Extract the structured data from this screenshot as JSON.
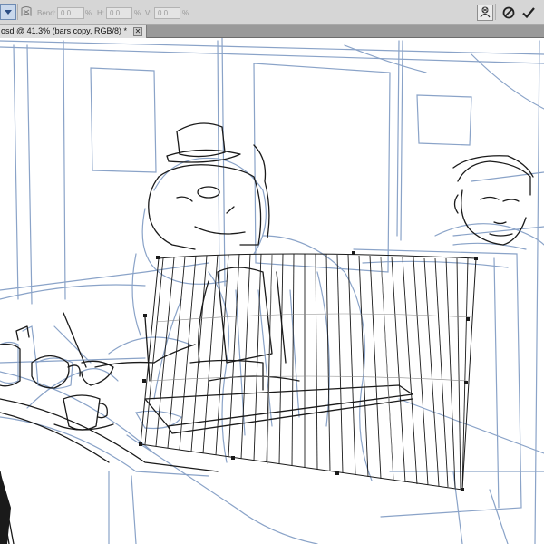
{
  "options_bar": {
    "bend_label": "Bend:",
    "bend_value": "0.0",
    "h_label": "H:",
    "h_value": "0.0",
    "v_label": "V:",
    "v_value": "0.0",
    "percent": "%"
  },
  "document_tab": {
    "title": "osd @ 41.3% (bars copy, RGB/8)",
    "modified_marker": "*",
    "close_glyph": "✕"
  },
  "colors": {
    "sketch_blue": "#8aa3c8",
    "ink_black": "#1a1a1a",
    "toolbar_bg": "#d6d6d6",
    "tab_bg": "#dedede"
  }
}
